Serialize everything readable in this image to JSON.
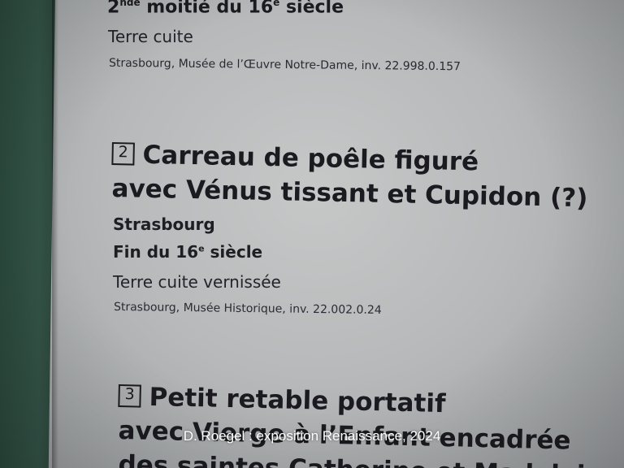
{
  "entry1": {
    "date_prefix": "2",
    "date_sup1": "nde",
    "date_mid": " moitié du 16",
    "date_sup2": "e",
    "date_suffix": " siècle",
    "material": "Terre cuite",
    "inventory": "Strasbourg, Musée de l’Œuvre Notre-Dame, inv. 22.998.0.157"
  },
  "entry2": {
    "number": "2",
    "title_line1": "Carreau de poêle figuré",
    "title_line2": "avec Vénus tissant et Cupidon (?)",
    "place": "Strasbourg",
    "date_prefix": "Fin du 16",
    "date_sup": "e",
    "date_suffix": " siècle",
    "material": "Terre cuite vernissée",
    "inventory": "Strasbourg, Musée Historique, inv. 22.002.0.24"
  },
  "entry3": {
    "number": "3",
    "title_line1": "Petit retable portatif",
    "title_line2": "avec Vierge à l’Enfant encadrée",
    "title_line3": "des saintes Catherine et Madeleine"
  },
  "watermark": "D. Roegel : exposition Renaissance, 2024",
  "colors": {
    "wall": "#2f4a3f",
    "card": "#b9bbbc",
    "text": "#1b1a20",
    "watermark": "#ffffff"
  }
}
